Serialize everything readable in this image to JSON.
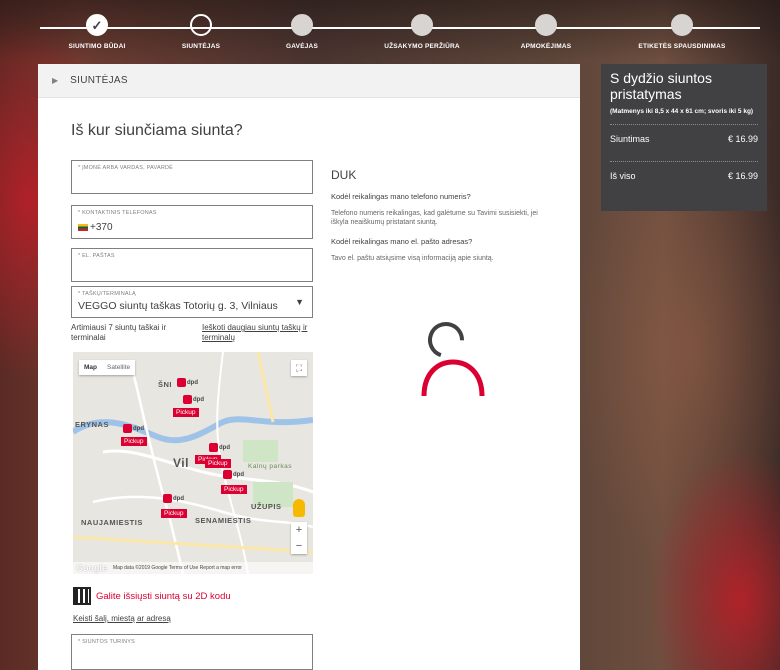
{
  "steps": [
    {
      "label": "Siuntimo būdai",
      "state": "done",
      "check": "✓"
    },
    {
      "label": "Siuntėjas",
      "state": "current"
    },
    {
      "label": "Gavėjas",
      "state": "todo"
    },
    {
      "label": "Užsakymo peržiūra",
      "state": "todo"
    },
    {
      "label": "Apmokėjimas",
      "state": "todo"
    },
    {
      "label": "Etiketės spausdinimas",
      "state": "todo"
    }
  ],
  "section": {
    "caret": "▶",
    "title": "SIUNTĖJAS"
  },
  "question": "Iš kur siunčiama siunta?",
  "form": {
    "company": {
      "label": "* Įmonė arba vardas, pavardė",
      "value": ""
    },
    "phone": {
      "label": "* Kontaktinis telefonas",
      "value": "+370"
    },
    "email": {
      "label": "* El. paštas",
      "value": ""
    },
    "terminal": {
      "label": "* Taškų/terminalą",
      "value": "VEGGO siuntų taškas Totorių g. 3, Vilniaus",
      "arrow": "▼"
    },
    "nearest_text": "Artimiausi 7 siuntų taškai ir terminalai",
    "more_link": "Ieškoti daugiau siuntų taškų ir terminalų",
    "qr_text": "Galite išsiųsti siuntą su 2D kodu",
    "change_link": "Keisti šalį, miestą ar adresą",
    "content": {
      "label": "* Siuntos turinys",
      "value": ""
    }
  },
  "map": {
    "type_map": "Map",
    "type_satellite": "Satellite",
    "fullscreen": "⛶",
    "zoom_in": "+",
    "zoom_out": "−",
    "google": "Google",
    "footer": "Map data ©2019 Google   Terms of Use   Report a map error",
    "labels": {
      "sni": "ŠNI",
      "erynas": "ERYNAS",
      "vil": "Vil",
      "uzupis": "UŽUPIS",
      "naujamiestis": "NAUJAMIESTIS",
      "senamiestis": "SENAMIESTIS",
      "kalnu": "Kalnų parkas"
    },
    "pin_label": "dpd",
    "pickup_label": "Pickup"
  },
  "faq": {
    "title": "DUK",
    "q1": "Kodėl reikalingas mano telefono numeris?",
    "a1": "Telefono numeris reikalingas, kad galėtume su Tavimi susisiekti, jei iškyla neaiškumų pristatant siuntą.",
    "q2": "Kodėl reikalingas mano el. pašto adresas?",
    "a2": "Tavo el. paštu atsiųsime visą informaciją apie siuntą."
  },
  "summary": {
    "title": "S dydžio siuntos pristatymas",
    "dims": "(Matmenys iki 8,5 x 44 x 61 cm; svoris iki 5 kg)",
    "shipping_label": "Siuntimas",
    "shipping_value": "€ 16.99",
    "total_label": "Iš viso",
    "total_value": "€ 16.99"
  },
  "colors": {
    "accent": "#dc0032",
    "dark": "#414042"
  }
}
